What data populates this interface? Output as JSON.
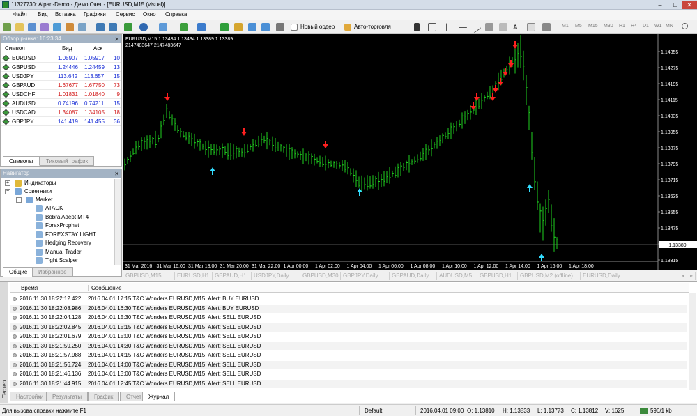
{
  "window": {
    "title": "11327730: Alpari-Demo - Демо Счет - [EURUSD,M15 (visual)]"
  },
  "menu": [
    "Файл",
    "Вид",
    "Вставка",
    "Графики",
    "Сервис",
    "Окно",
    "Справка"
  ],
  "toolbar": {
    "new_order": "Новый ордер",
    "auto_trading": "Авто-торговля",
    "timeframes": [
      "M1",
      "M5",
      "M15",
      "M30",
      "H1",
      "H4",
      "D1",
      "W1",
      "MN"
    ]
  },
  "market_watch": {
    "title": "Обзор рынка: 16:23:34",
    "columns": {
      "symbol": "Символ",
      "bid": "Бид",
      "ask": "Аск"
    },
    "rows": [
      {
        "symbol": "EURUSD",
        "bid": "1.05907",
        "ask": "1.05917",
        "spread": "10",
        "color": "#1a2fd6"
      },
      {
        "symbol": "GBPUSD",
        "bid": "1.24446",
        "ask": "1.24459",
        "spread": "13",
        "color": "#1a2fd6"
      },
      {
        "symbol": "USDJPY",
        "bid": "113.642",
        "ask": "113.657",
        "spread": "15",
        "color": "#1a2fd6"
      },
      {
        "symbol": "GBPAUD",
        "bid": "1.67677",
        "ask": "1.67750",
        "spread": "73",
        "color": "#d31e1e"
      },
      {
        "symbol": "USDCHF",
        "bid": "1.01831",
        "ask": "1.01840",
        "spread": "9",
        "color": "#d31e1e"
      },
      {
        "symbol": "AUDUSD",
        "bid": "0.74196",
        "ask": "0.74211",
        "spread": "15",
        "color": "#1a2fd6"
      },
      {
        "symbol": "USDCAD",
        "bid": "1.34087",
        "ask": "1.34105",
        "spread": "18",
        "color": "#d31e1e"
      },
      {
        "symbol": "GBPJPY",
        "bid": "141.419",
        "ask": "141.455",
        "spread": "36",
        "color": "#1a2fd6"
      }
    ],
    "tabs": [
      "Символы",
      "Тиковый график"
    ]
  },
  "navigator": {
    "title": "Навигатор",
    "items": [
      "Индикаторы",
      "Советники",
      "Market",
      "ATACK",
      "Bobra Adept MT4",
      "ForexProphet",
      "FOREXSTAY LIGHT",
      "Hedging Recovery",
      "Manual Trader",
      "Tight Scalper"
    ],
    "tabs": [
      "Общие",
      "Избранное"
    ]
  },
  "chart": {
    "header_line1": "EURUSD,M15  1.13434 1.13434 1.13389 1.13389",
    "header_line2": "2147483647 2147483647",
    "price_labels": [
      "1.14355",
      "1.14275",
      "1.14195",
      "1.14115",
      "1.14035",
      "1.13955",
      "1.13875",
      "1.13795",
      "1.13715",
      "1.13635",
      "1.13555",
      "1.13475",
      "1.13395",
      "1.13315"
    ],
    "current_price": "1.13389",
    "time_labels": [
      "31 Mar 2016",
      "31 Mar 16:00",
      "31 Mar 18:00",
      "31 Mar 20:00",
      "31 Mar 22:00",
      "1 Apr 00:00",
      "1 Apr 02:00",
      "1 Apr 04:00",
      "1 Apr 06:00",
      "1 Apr 08:00",
      "1 Apr 10:00",
      "1 Apr 12:00",
      "1 Apr 14:00",
      "1 Apr 16:00",
      "1 Apr 18:00"
    ],
    "tabs": [
      "GBPUSD,M15",
      "EURUSD,H1",
      "GBPAUD,H1",
      "USDJPY,Daily",
      "GBPUSD,M30",
      "GBPJPY,Daily",
      "GBPAUD,Daily",
      "AUDUSD,M5",
      "GBPUSD,H1",
      "GBPUSD,M2 (offline)",
      "EURUSD,Daily"
    ]
  },
  "terminal": {
    "side_label": "Тестер",
    "columns": {
      "time": "Время",
      "message": "Сообщение"
    },
    "rows": [
      {
        "time": "2016.11.30 18:22:12.422",
        "message": "2016.04.01 17:15  T&C Wonders EURUSD,M15: Alert: BUY EURUSD"
      },
      {
        "time": "2016.11.30 18:22:08.986",
        "message": "2016.04.01 16:30  T&C Wonders EURUSD,M15: Alert: BUY EURUSD"
      },
      {
        "time": "2016.11.30 18:22:04.128",
        "message": "2016.04.01 15:30  T&C Wonders EURUSD,M15: Alert: SELL EURUSD"
      },
      {
        "time": "2016.11.30 18:22:02.845",
        "message": "2016.04.01 15:15  T&C Wonders EURUSD,M15: Alert: SELL EURUSD"
      },
      {
        "time": "2016.11.30 18:22:01.679",
        "message": "2016.04.01 15:00  T&C Wonders EURUSD,M15: Alert: SELL EURUSD"
      },
      {
        "time": "2016.11.30 18:21:59.250",
        "message": "2016.04.01 14:30  T&C Wonders EURUSD,M15: Alert: SELL EURUSD"
      },
      {
        "time": "2016.11.30 18:21:57.988",
        "message": "2016.04.01 14:15  T&C Wonders EURUSD,M15: Alert: SELL EURUSD"
      },
      {
        "time": "2016.11.30 18:21:56.724",
        "message": "2016.04.01 14:00  T&C Wonders EURUSD,M15: Alert: SELL EURUSD"
      },
      {
        "time": "2016.11.30 18:21:46.136",
        "message": "2016.04.01 13:00  T&C Wonders EURUSD,M15: Alert: SELL EURUSD"
      },
      {
        "time": "2016.11.30 18:21:44.915",
        "message": "2016.04.01 12:45  T&C Wonders EURUSD,M15: Alert: SELL EURUSD"
      }
    ],
    "tabs": [
      "Настройки",
      "Результаты",
      "График",
      "Отчет",
      "Журнал"
    ]
  },
  "status": {
    "help": "Для вызова справки нажмите F1",
    "profile": "Default",
    "datetime": "2016.04.01 09:00",
    "open": "O: 1.13810",
    "high": "H: 1.13833",
    "low": "L: 1.13773",
    "close": "C: 1.13812",
    "volume": "V: 1625",
    "traffic": "596/1 kb"
  }
}
